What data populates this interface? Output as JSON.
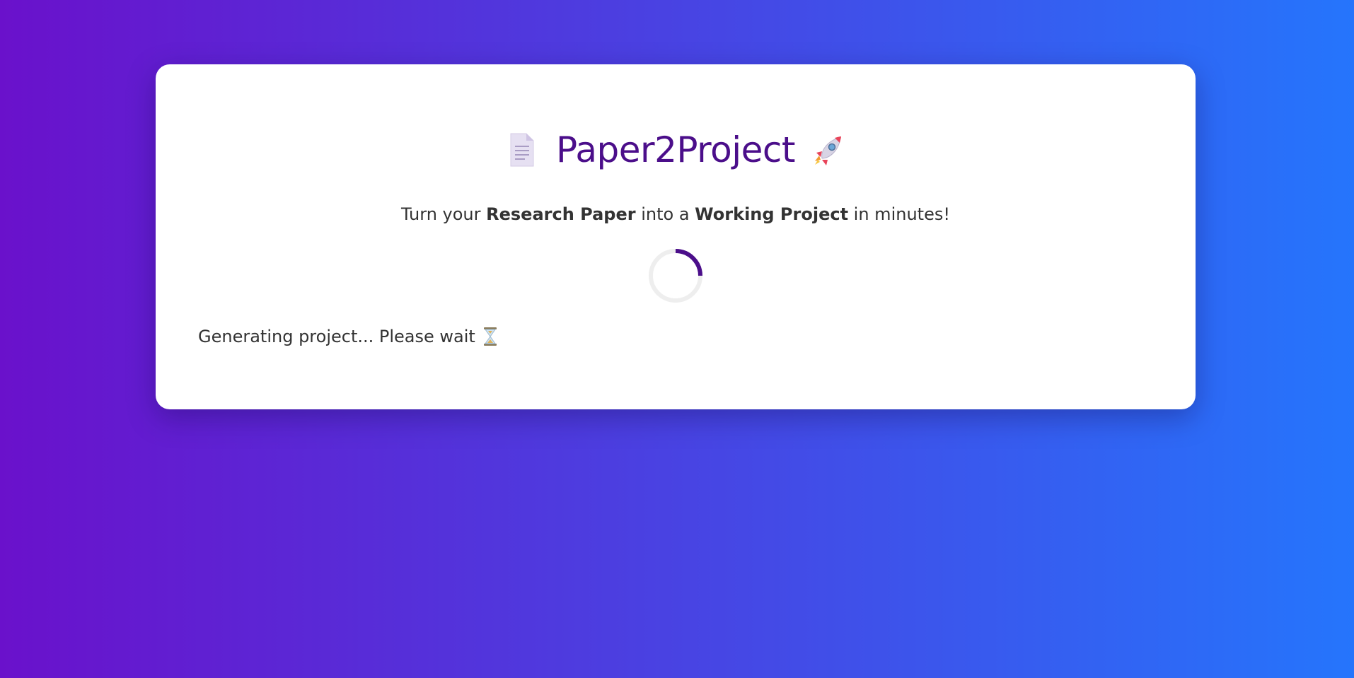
{
  "header": {
    "title": "Paper2Project",
    "title_color": "#4b0e8a",
    "left_icon": "document-icon",
    "right_icon": "rocket-icon"
  },
  "tagline": {
    "part1": "Turn your ",
    "bold1": "Research Paper",
    "part2": " into a ",
    "bold2": "Working Project",
    "part3": " in minutes!"
  },
  "loader": {
    "icon": "spinner-icon",
    "accent": "#4b0e8a",
    "track": "#eeeeee"
  },
  "status": {
    "text": "Generating project... Please wait",
    "icon": "hourglass-icon"
  },
  "theme": {
    "gradient_start": "#6a11cb",
    "gradient_end": "#2575fc",
    "card_background": "#ffffff"
  }
}
